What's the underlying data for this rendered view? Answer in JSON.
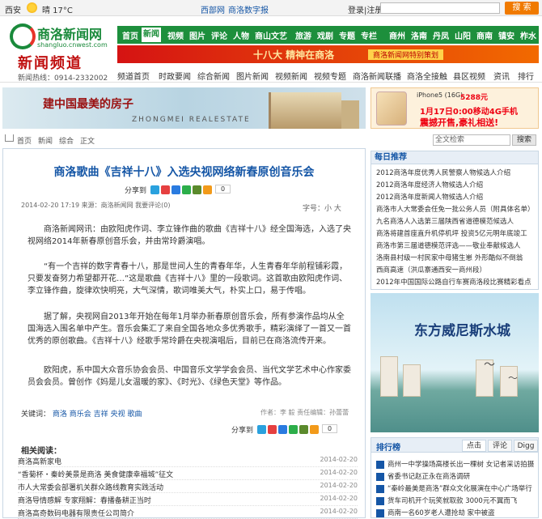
{
  "topbar": {
    "city": "西安",
    "weather": "晴 17°C",
    "home": "西部网",
    "site": "商洛数字报",
    "login": "登录|注册",
    "search_placeholder": "",
    "search_btn": "搜 索"
  },
  "logo": {
    "name": "商洛新闻网",
    "url": "shangluo.cnwest.com",
    "channel": "新闻频道",
    "hotline": "新闻热线：0914-2332002"
  },
  "nav": [
    "首页",
    "新闻",
    "视频",
    "图片",
    "评论",
    "人物",
    "商山文艺",
    "旅游",
    "戏剧",
    "专题",
    "专栏",
    "商州",
    "洛南",
    "丹凤",
    "山阳",
    "商南",
    "镇安",
    "柞水"
  ],
  "banner": {
    "text": "十八大 精神在商洛",
    "tag": "商洛新闻网特别策划"
  },
  "subnav": [
    "频道首页",
    "时政要闻",
    "综合新闻",
    "图片新闻",
    "视频新闻",
    "视频专题",
    "商洛新闻联播",
    "商洛全接触",
    "县区视频",
    "资讯",
    "排行"
  ],
  "ad1": {
    "slogan": "建中国最美的房子",
    "brand": "ZHONGMEI REALESTATE"
  },
  "ad2": {
    "model": "iPhone5 (16G)",
    "price": "5288元",
    "date_line": "1月17日0:00移动4G手机",
    "promo": "震撼开售,豪礼相送!"
  },
  "breadcrumb": [
    "首页",
    "新闻",
    "综合",
    "正文"
  ],
  "search": {
    "placeholder": "全文检索",
    "btn": "搜索"
  },
  "article": {
    "title": "商洛歌曲《吉祥十八》入选央视网络新春原创音乐会",
    "share_label": "分享到",
    "share_count": "0",
    "meta": "2014-02-20 17:19   来源：商洛新闻网   我要评论(0)",
    "fontsize_label": "字号：小  大",
    "paras": [
      "商洛新闻网讯：由欧阳虎作词、李立锋作曲的歌曲《吉祥十八》经全国海选，入选了央视网络2014年新春原创音乐会，并由常玲爵演唱。",
      "“有一个吉祥的数字青春十八，那是世间人生的青春年华，人生青春年华前程铺彩霞，只要发奋努力希望都开花…”这是歌曲《吉祥十八》里的一段歌词。这首歌由欧阳虎作词、李立锋作曲，旋律欢快明亮，大气深情，歌词唯美大气，朴实上口，易于传唱。",
      "据了解，央视网自2013年开始在每年1月举办新春原创音乐会，所有参演作品均从全国海选入围名单中产生。音乐会集汇了来自全国各地众多优秀歌手，精彩演绎了一首又一首优秀的原创歌曲。《吉祥十八》经歌手常玲爵在央视演唱后，目前已在商洛流传开来。",
      "欧阳虎，系中国大众音乐协会会员、中国音乐文学学会会员、当代文学艺术中心作家委员会会员。曾创作《妈是儿女温暖的家》、《时光》、《绿色天堂》等作品。"
    ],
    "keywords_label": "关键词：",
    "keywords": [
      "商洛",
      "商乐会",
      "吉祥",
      "央视",
      "歌曲"
    ],
    "author": "作者：李 毅  责任编辑：孙蕾蕾",
    "related_label": "相关阅读：",
    "related": [
      {
        "t": "商洛高新家电",
        "d": "2014-02-20"
      },
      {
        "t": "“香菊杯・秦岭美景是商洛 美食健康幸福城”征文",
        "d": "2014-02-20"
      },
      {
        "t": "市人大常委会部署机关群众路线教育实践活动",
        "d": "2014-02-20"
      },
      {
        "t": "商洛导情感解 专家翔解：春播备耕正当时",
        "d": "2014-02-20"
      },
      {
        "t": "商洛高奇数码电器有限责任公司简介",
        "d": "2014-02-20"
      }
    ]
  },
  "daily": {
    "title": "每日推荐",
    "items": [
      "2012商洛年度优秀人民警察人物候选人介绍",
      "2012商洛年度经济人物候选人介绍",
      "2012商洛年度新闻人物候选人介绍",
      "商洛市人大常委会任免一批公务人员（附具体名单）",
      "九名商洛人入选第三届陕西省道德模范候选人",
      "商洛将建首座直升机停机坪 投资5亿元明年底竣工",
      "商洛市第三届道德模范评选——敬业奉献候选人",
      "洛南县村级一村民家中母猪生崽 外形酷似不倒翁",
      "西商高速（洪瓜寨通西安一商州段）",
      "2012年中国国际公路自行车赛商洛段比赛精彩看点"
    ]
  },
  "ad3": {
    "slogan": "东方威尼斯水城"
  },
  "rank": {
    "title": "排行榜",
    "tabs": [
      "点击",
      "评论",
      "Digg"
    ],
    "items": [
      "商州一中学操场高楼长出一棵树 女记者采访拍摄",
      "省委书记赵正永在商洛调研",
      "“秦岭最美是商洛”群众文化展演在中心广场举行",
      "货车司机开个玩笑就取款 3000元不翼而飞",
      "商南一名60岁老人遭抢劫 家中被盗"
    ]
  }
}
